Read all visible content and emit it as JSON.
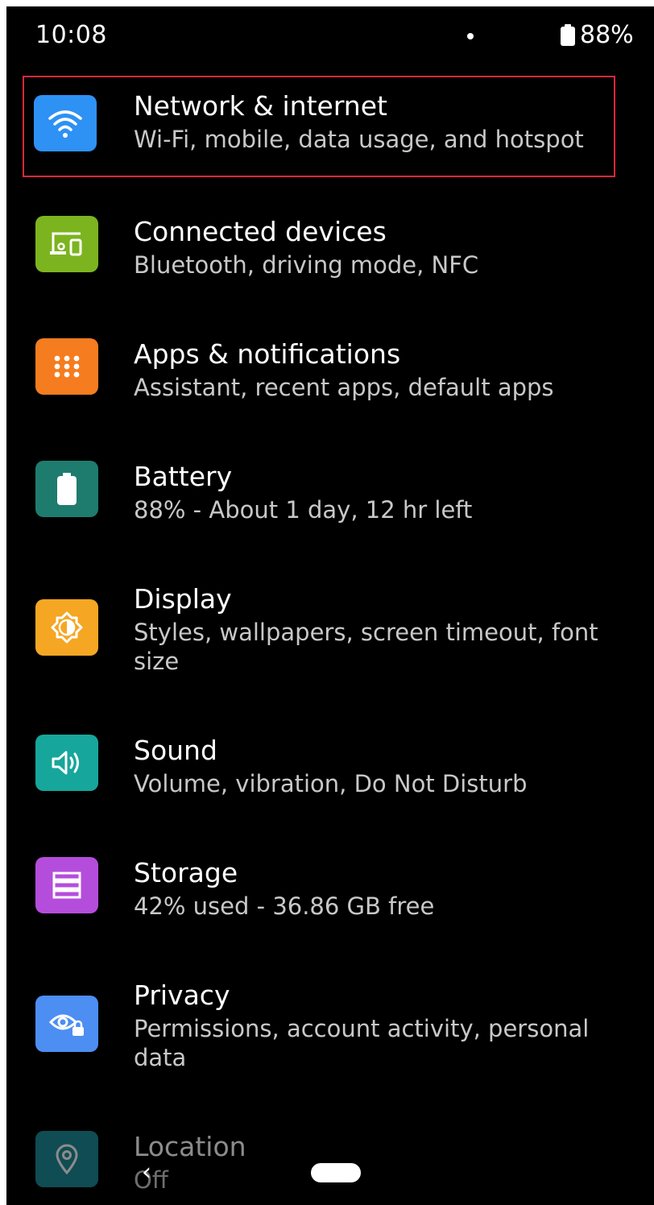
{
  "status_bar": {
    "time": "10:08",
    "battery": "88%"
  },
  "settings": [
    {
      "title": "Network & internet",
      "subtitle": "Wi-Fi, mobile, data usage, and hotspot",
      "icon": "wifi-icon",
      "color": "#2e91f4",
      "highlighted": true
    },
    {
      "title": "Connected devices",
      "subtitle": "Bluetooth, driving mode, NFC",
      "icon": "devices-icon",
      "color": "#7cb41f"
    },
    {
      "title": "Apps & notifications",
      "subtitle": "Assistant, recent apps, default apps",
      "icon": "apps-grid-icon",
      "color": "#f57c1f"
    },
    {
      "title": "Battery",
      "subtitle": "88% - About 1 day, 12 hr left",
      "icon": "battery-icon",
      "color": "#1e7c6e"
    },
    {
      "title": "Display",
      "subtitle": "Styles, wallpapers, screen timeout, font size",
      "icon": "brightness-icon",
      "color": "#f5a623"
    },
    {
      "title": "Sound",
      "subtitle": "Volume, vibration, Do Not Disturb",
      "icon": "volume-icon",
      "color": "#17a69b"
    },
    {
      "title": "Storage",
      "subtitle": "42% used - 36.86 GB free",
      "icon": "storage-icon",
      "color": "#b54ddc"
    },
    {
      "title": "Privacy",
      "subtitle": "Permissions, account activity, personal data",
      "icon": "privacy-eye-icon",
      "color": "#4c8ef2"
    },
    {
      "title": "Location",
      "subtitle": "Off",
      "icon": "location-pin-icon",
      "color": "#1e8a98",
      "dimmed": true
    }
  ],
  "nav_bar": {
    "back_glyph": "‹"
  }
}
